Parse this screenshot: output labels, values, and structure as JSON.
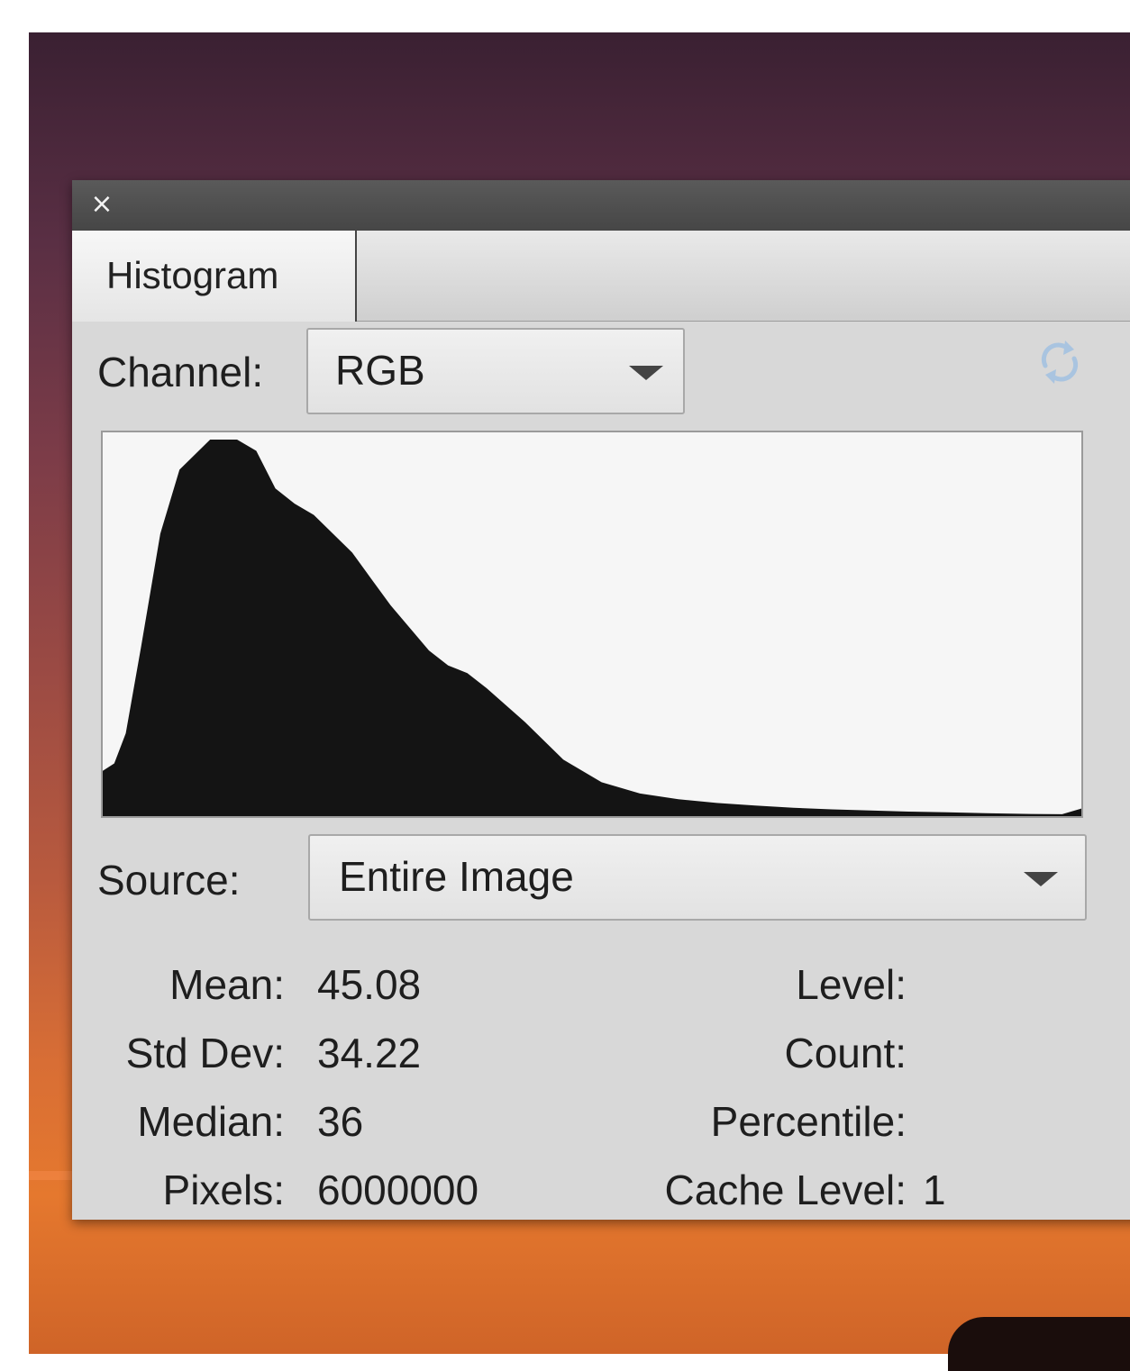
{
  "panel": {
    "close_glyph": "×",
    "tab_label": "Histogram",
    "refresh_icon": "refresh-icon"
  },
  "channel": {
    "label": "Channel:",
    "value": "RGB"
  },
  "source": {
    "label": "Source:",
    "value": "Entire Image"
  },
  "stats": {
    "mean_label": "Mean:",
    "mean_value": "45.08",
    "std_label": "Std Dev:",
    "std_value": "34.22",
    "median_label": "Median:",
    "median_value": "36",
    "pixels_label": "Pixels:",
    "pixels_value": "6000000",
    "level_label": "Level:",
    "count_label": "Count:",
    "percentile_label": "Percentile:",
    "cache_label": "Cache Level:",
    "cache_value": "1"
  },
  "chart_data": {
    "type": "area",
    "x": [
      0,
      3,
      6,
      10,
      15,
      20,
      28,
      35,
      40,
      45,
      50,
      55,
      60,
      65,
      70,
      75,
      80,
      85,
      90,
      95,
      100,
      110,
      120,
      130,
      140,
      150,
      160,
      170,
      180,
      190,
      200,
      210,
      220,
      230,
      240,
      250,
      255
    ],
    "values": [
      0.12,
      0.14,
      0.22,
      0.45,
      0.75,
      0.92,
      1.0,
      1.0,
      0.97,
      0.87,
      0.83,
      0.8,
      0.75,
      0.7,
      0.63,
      0.56,
      0.5,
      0.44,
      0.4,
      0.38,
      0.34,
      0.25,
      0.15,
      0.09,
      0.06,
      0.045,
      0.035,
      0.028,
      0.022,
      0.018,
      0.015,
      0.012,
      0.01,
      0.008,
      0.006,
      0.005,
      0.02
    ],
    "xlim": [
      0,
      255
    ],
    "ylim": [
      0,
      1
    ],
    "color": "#141414",
    "background": "#f6f6f6"
  }
}
